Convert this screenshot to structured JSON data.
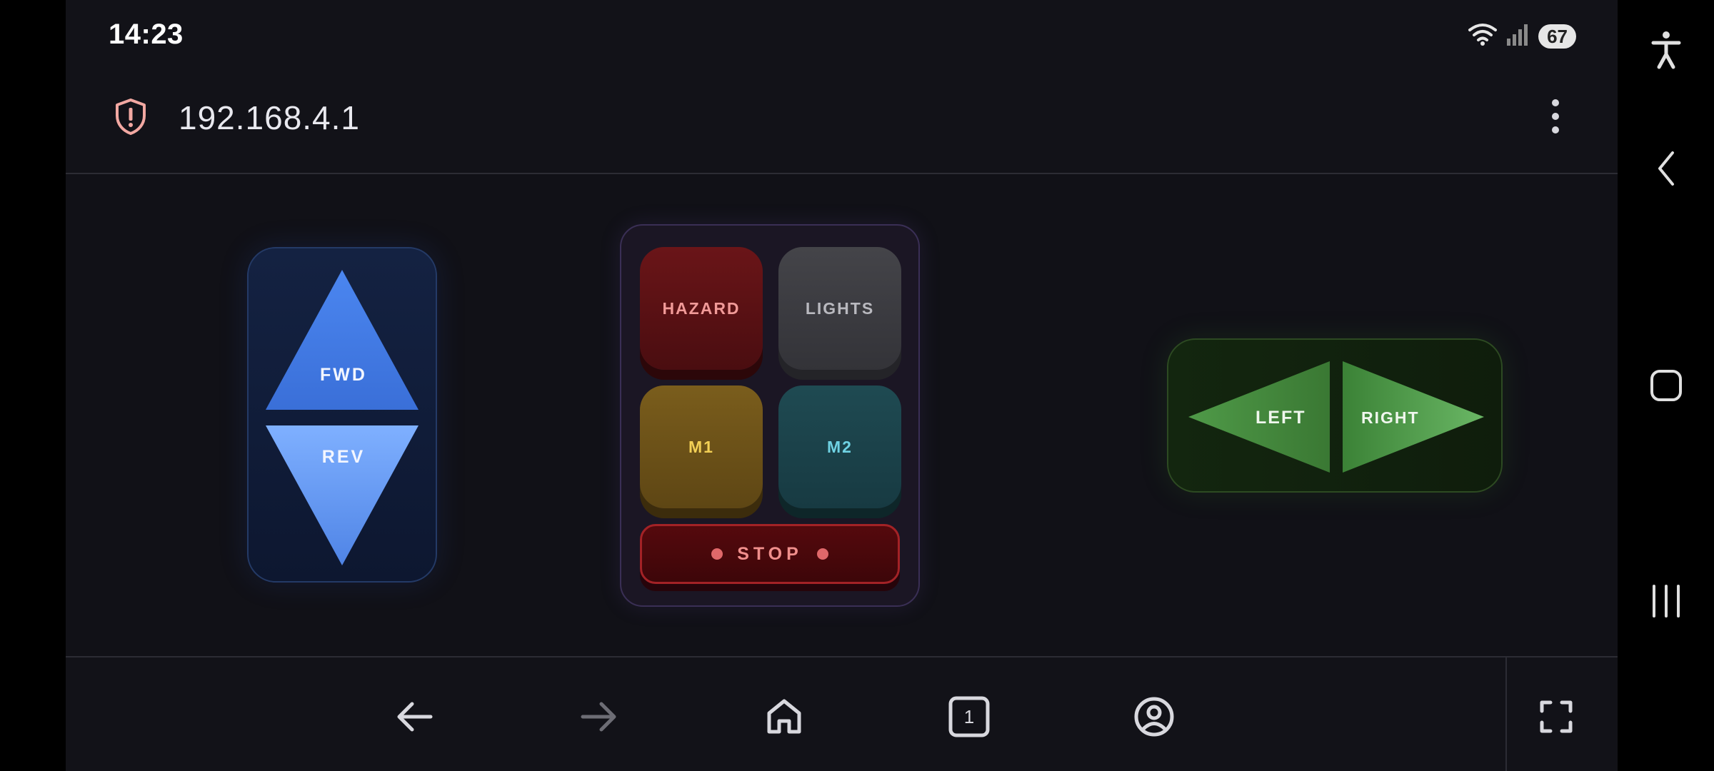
{
  "status_bar": {
    "time": "14:23",
    "battery": "67",
    "icons": [
      "wifi-icon",
      "signal-icon"
    ]
  },
  "browser": {
    "url": "192.168.4.1",
    "tab_count": "1"
  },
  "drive_pad": {
    "fwd_label": "FWD",
    "rev_label": "REV",
    "colors": {
      "fwd": "#3a6fd8",
      "rev": "#6a9ef2"
    }
  },
  "aux_panel": {
    "hazard_label": "HAZARD",
    "lights_label": "LIGHTS",
    "m1_label": "M1",
    "m2_label": "M2",
    "stop_label": "STOP",
    "colors": {
      "hazard": "#6a1518",
      "lights": "#3b3b40",
      "m1": "#6e5419",
      "m2": "#1c444b",
      "stop": "#a32226"
    }
  },
  "steer_pad": {
    "left_label": "LEFT",
    "right_label": "RIGHT",
    "colors": {
      "left": "#4f9a48",
      "right": "#6ab765"
    }
  },
  "bottom_nav": {
    "icons": [
      "back-arrow-icon",
      "forward-arrow-icon",
      "home-icon",
      "tabs-icon",
      "account-icon",
      "fullscreen-icon"
    ]
  },
  "system_nav": {
    "icons": [
      "accessibility-icon",
      "back-icon",
      "home-icon",
      "recents-icon"
    ]
  }
}
